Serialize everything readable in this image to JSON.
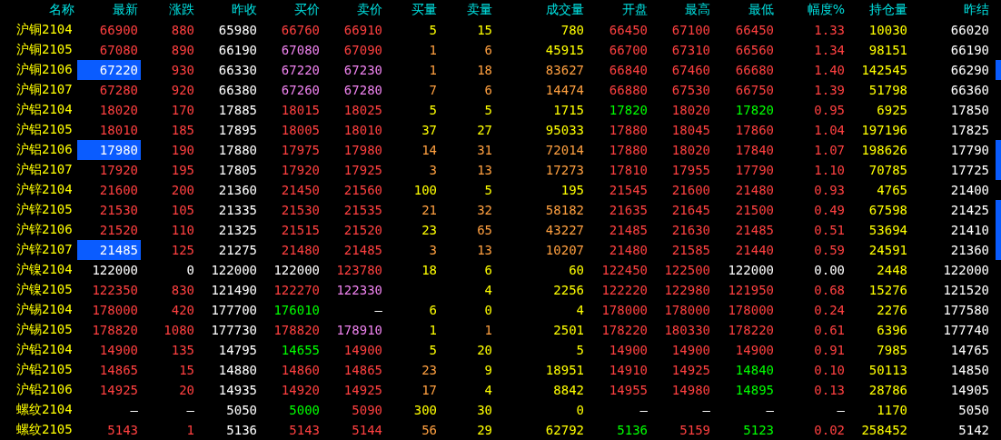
{
  "columns": [
    "名称",
    "最新",
    "涨跌",
    "昨收",
    "买价",
    "卖价",
    "买量",
    "卖量",
    "成交量",
    "开盘",
    "最高",
    "最低",
    "幅度%",
    "持仓量",
    "昨结"
  ],
  "rows": [
    {
      "name": "沪铜2104",
      "flash": false,
      "marked": false,
      "cells": [
        {
          "text": "66900",
          "color": "#ff4040"
        },
        {
          "text": "880",
          "color": "#ff4040"
        },
        {
          "text": "65980",
          "color": "#ffffff"
        },
        {
          "text": "66760",
          "color": "#ff4040"
        },
        {
          "text": "66910",
          "color": "#ff4040"
        },
        {
          "text": "5",
          "color": "#ffff00"
        },
        {
          "text": "15",
          "color": "#ffff00"
        },
        {
          "text": "780",
          "color": "#ffff00"
        },
        {
          "text": "66450",
          "color": "#ff4040"
        },
        {
          "text": "67100",
          "color": "#ff4040"
        },
        {
          "text": "66450",
          "color": "#ff4040"
        },
        {
          "text": "1.33",
          "color": "#ff4040"
        },
        {
          "text": "10030",
          "color": "#ffff00"
        },
        {
          "text": "66020",
          "color": "#ffffff"
        }
      ]
    },
    {
      "name": "沪铜2105",
      "flash": false,
      "marked": false,
      "cells": [
        {
          "text": "67080",
          "color": "#ff4040"
        },
        {
          "text": "890",
          "color": "#ff4040"
        },
        {
          "text": "66190",
          "color": "#ffffff"
        },
        {
          "text": "67080",
          "color": "#ee82ee"
        },
        {
          "text": "67090",
          "color": "#ff4040"
        },
        {
          "text": "1",
          "color": "#ffa040"
        },
        {
          "text": "6",
          "color": "#ffa040"
        },
        {
          "text": "45915",
          "color": "#ffff00"
        },
        {
          "text": "66700",
          "color": "#ff4040"
        },
        {
          "text": "67310",
          "color": "#ff4040"
        },
        {
          "text": "66560",
          "color": "#ff4040"
        },
        {
          "text": "1.34",
          "color": "#ff4040"
        },
        {
          "text": "98151",
          "color": "#ffff00"
        },
        {
          "text": "66190",
          "color": "#ffffff"
        }
      ]
    },
    {
      "name": "沪铜2106",
      "flash": true,
      "marked": true,
      "cells": [
        {
          "text": "67220",
          "color": "#ffffff"
        },
        {
          "text": "930",
          "color": "#ff4040"
        },
        {
          "text": "66330",
          "color": "#ffffff"
        },
        {
          "text": "67220",
          "color": "#ee82ee"
        },
        {
          "text": "67230",
          "color": "#ee82ee"
        },
        {
          "text": "1",
          "color": "#ffa040"
        },
        {
          "text": "18",
          "color": "#ffa040"
        },
        {
          "text": "83627",
          "color": "#ffa040"
        },
        {
          "text": "66840",
          "color": "#ff4040"
        },
        {
          "text": "67460",
          "color": "#ff4040"
        },
        {
          "text": "66680",
          "color": "#ff4040"
        },
        {
          "text": "1.40",
          "color": "#ff4040"
        },
        {
          "text": "142545",
          "color": "#ffff00"
        },
        {
          "text": "66290",
          "color": "#ffffff"
        }
      ]
    },
    {
      "name": "沪铜2107",
      "flash": false,
      "marked": false,
      "cells": [
        {
          "text": "67280",
          "color": "#ff4040"
        },
        {
          "text": "920",
          "color": "#ff4040"
        },
        {
          "text": "66380",
          "color": "#ffffff"
        },
        {
          "text": "67260",
          "color": "#ee82ee"
        },
        {
          "text": "67280",
          "color": "#ee82ee"
        },
        {
          "text": "7",
          "color": "#ffa040"
        },
        {
          "text": "6",
          "color": "#ffa040"
        },
        {
          "text": "14474",
          "color": "#ffa040"
        },
        {
          "text": "66880",
          "color": "#ff4040"
        },
        {
          "text": "67530",
          "color": "#ff4040"
        },
        {
          "text": "66750",
          "color": "#ff4040"
        },
        {
          "text": "1.39",
          "color": "#ff4040"
        },
        {
          "text": "51798",
          "color": "#ffff00"
        },
        {
          "text": "66360",
          "color": "#ffffff"
        }
      ]
    },
    {
      "name": "沪铝2104",
      "flash": false,
      "marked": false,
      "cells": [
        {
          "text": "18020",
          "color": "#ff4040"
        },
        {
          "text": "170",
          "color": "#ff4040"
        },
        {
          "text": "17885",
          "color": "#ffffff"
        },
        {
          "text": "18015",
          "color": "#ff4040"
        },
        {
          "text": "18025",
          "color": "#ff4040"
        },
        {
          "text": "5",
          "color": "#ffff00"
        },
        {
          "text": "5",
          "color": "#ffff00"
        },
        {
          "text": "1715",
          "color": "#ffff00"
        },
        {
          "text": "17820",
          "color": "#00ff00"
        },
        {
          "text": "18020",
          "color": "#ff4040"
        },
        {
          "text": "17820",
          "color": "#00ff00"
        },
        {
          "text": "0.95",
          "color": "#ff4040"
        },
        {
          "text": "6925",
          "color": "#ffff00"
        },
        {
          "text": "17850",
          "color": "#ffffff"
        }
      ]
    },
    {
      "name": "沪铝2105",
      "flash": false,
      "marked": false,
      "cells": [
        {
          "text": "18010",
          "color": "#ff4040"
        },
        {
          "text": "185",
          "color": "#ff4040"
        },
        {
          "text": "17895",
          "color": "#ffffff"
        },
        {
          "text": "18005",
          "color": "#ff4040"
        },
        {
          "text": "18010",
          "color": "#ff4040"
        },
        {
          "text": "37",
          "color": "#ffff00"
        },
        {
          "text": "27",
          "color": "#ffff00"
        },
        {
          "text": "95033",
          "color": "#ffff00"
        },
        {
          "text": "17880",
          "color": "#ff4040"
        },
        {
          "text": "18045",
          "color": "#ff4040"
        },
        {
          "text": "17860",
          "color": "#ff4040"
        },
        {
          "text": "1.04",
          "color": "#ff4040"
        },
        {
          "text": "197196",
          "color": "#ffff00"
        },
        {
          "text": "17825",
          "color": "#ffffff"
        }
      ]
    },
    {
      "name": "沪铝2106",
      "flash": true,
      "marked": true,
      "cells": [
        {
          "text": "17980",
          "color": "#ffffff"
        },
        {
          "text": "190",
          "color": "#ff4040"
        },
        {
          "text": "17880",
          "color": "#ffffff"
        },
        {
          "text": "17975",
          "color": "#ff4040"
        },
        {
          "text": "17980",
          "color": "#ff4040"
        },
        {
          "text": "14",
          "color": "#ffa040"
        },
        {
          "text": "31",
          "color": "#ffa040"
        },
        {
          "text": "72014",
          "color": "#ffa040"
        },
        {
          "text": "17880",
          "color": "#ff4040"
        },
        {
          "text": "18020",
          "color": "#ff4040"
        },
        {
          "text": "17840",
          "color": "#ff4040"
        },
        {
          "text": "1.07",
          "color": "#ff4040"
        },
        {
          "text": "198626",
          "color": "#ffff00"
        },
        {
          "text": "17790",
          "color": "#ffffff"
        }
      ]
    },
    {
      "name": "沪铝2107",
      "flash": false,
      "marked": true,
      "cells": [
        {
          "text": "17920",
          "color": "#ff4040"
        },
        {
          "text": "195",
          "color": "#ff4040"
        },
        {
          "text": "17805",
          "color": "#ffffff"
        },
        {
          "text": "17920",
          "color": "#ff4040"
        },
        {
          "text": "17925",
          "color": "#ff4040"
        },
        {
          "text": "3",
          "color": "#ffa040"
        },
        {
          "text": "13",
          "color": "#ffa040"
        },
        {
          "text": "17273",
          "color": "#ffa040"
        },
        {
          "text": "17810",
          "color": "#ff4040"
        },
        {
          "text": "17955",
          "color": "#ff4040"
        },
        {
          "text": "17790",
          "color": "#ff4040"
        },
        {
          "text": "1.10",
          "color": "#ff4040"
        },
        {
          "text": "70785",
          "color": "#ffff00"
        },
        {
          "text": "17725",
          "color": "#ffffff"
        }
      ]
    },
    {
      "name": "沪锌2104",
      "flash": false,
      "marked": false,
      "cells": [
        {
          "text": "21600",
          "color": "#ff4040"
        },
        {
          "text": "200",
          "color": "#ff4040"
        },
        {
          "text": "21360",
          "color": "#ffffff"
        },
        {
          "text": "21450",
          "color": "#ff4040"
        },
        {
          "text": "21560",
          "color": "#ff4040"
        },
        {
          "text": "100",
          "color": "#ffff00"
        },
        {
          "text": "5",
          "color": "#ffff00"
        },
        {
          "text": "195",
          "color": "#ffff00"
        },
        {
          "text": "21545",
          "color": "#ff4040"
        },
        {
          "text": "21600",
          "color": "#ff4040"
        },
        {
          "text": "21480",
          "color": "#ff4040"
        },
        {
          "text": "0.93",
          "color": "#ff4040"
        },
        {
          "text": "4765",
          "color": "#ffff00"
        },
        {
          "text": "21400",
          "color": "#ffffff"
        }
      ]
    },
    {
      "name": "沪锌2105",
      "flash": false,
      "marked": true,
      "cells": [
        {
          "text": "21530",
          "color": "#ff4040"
        },
        {
          "text": "105",
          "color": "#ff4040"
        },
        {
          "text": "21335",
          "color": "#ffffff"
        },
        {
          "text": "21530",
          "color": "#ff4040"
        },
        {
          "text": "21535",
          "color": "#ff4040"
        },
        {
          "text": "21",
          "color": "#ffa040"
        },
        {
          "text": "32",
          "color": "#ffa040"
        },
        {
          "text": "58182",
          "color": "#ffa040"
        },
        {
          "text": "21635",
          "color": "#ff4040"
        },
        {
          "text": "21645",
          "color": "#ff4040"
        },
        {
          "text": "21500",
          "color": "#ff4040"
        },
        {
          "text": "0.49",
          "color": "#ff4040"
        },
        {
          "text": "67598",
          "color": "#ffff00"
        },
        {
          "text": "21425",
          "color": "#ffffff"
        }
      ]
    },
    {
      "name": "沪锌2106",
      "flash": false,
      "marked": true,
      "cells": [
        {
          "text": "21520",
          "color": "#ff4040"
        },
        {
          "text": "110",
          "color": "#ff4040"
        },
        {
          "text": "21325",
          "color": "#ffffff"
        },
        {
          "text": "21515",
          "color": "#ff4040"
        },
        {
          "text": "21520",
          "color": "#ff4040"
        },
        {
          "text": "23",
          "color": "#ffff00"
        },
        {
          "text": "65",
          "color": "#ffa040"
        },
        {
          "text": "43227",
          "color": "#ffa040"
        },
        {
          "text": "21485",
          "color": "#ff4040"
        },
        {
          "text": "21630",
          "color": "#ff4040"
        },
        {
          "text": "21485",
          "color": "#ff4040"
        },
        {
          "text": "0.51",
          "color": "#ff4040"
        },
        {
          "text": "53694",
          "color": "#ffff00"
        },
        {
          "text": "21410",
          "color": "#ffffff"
        }
      ]
    },
    {
      "name": "沪锌2107",
      "flash": true,
      "marked": true,
      "cells": [
        {
          "text": "21485",
          "color": "#ffffff"
        },
        {
          "text": "125",
          "color": "#ff4040"
        },
        {
          "text": "21275",
          "color": "#ffffff"
        },
        {
          "text": "21480",
          "color": "#ff4040"
        },
        {
          "text": "21485",
          "color": "#ff4040"
        },
        {
          "text": "3",
          "color": "#ffa040"
        },
        {
          "text": "13",
          "color": "#ffa040"
        },
        {
          "text": "10207",
          "color": "#ffa040"
        },
        {
          "text": "21480",
          "color": "#ff4040"
        },
        {
          "text": "21585",
          "color": "#ff4040"
        },
        {
          "text": "21440",
          "color": "#ff4040"
        },
        {
          "text": "0.59",
          "color": "#ff4040"
        },
        {
          "text": "24591",
          "color": "#ffff00"
        },
        {
          "text": "21360",
          "color": "#ffffff"
        }
      ]
    },
    {
      "name": "沪镍2104",
      "flash": false,
      "marked": false,
      "cells": [
        {
          "text": "122000",
          "color": "#ffffff"
        },
        {
          "text": "0",
          "color": "#ffffff"
        },
        {
          "text": "122000",
          "color": "#ffffff"
        },
        {
          "text": "122000",
          "color": "#ffffff"
        },
        {
          "text": "123780",
          "color": "#ff4040"
        },
        {
          "text": "18",
          "color": "#ffff00"
        },
        {
          "text": "6",
          "color": "#ffff00"
        },
        {
          "text": "60",
          "color": "#ffff00"
        },
        {
          "text": "122450",
          "color": "#ff4040"
        },
        {
          "text": "122500",
          "color": "#ff4040"
        },
        {
          "text": "122000",
          "color": "#ffffff"
        },
        {
          "text": "0.00",
          "color": "#ffffff"
        },
        {
          "text": "2448",
          "color": "#ffff00"
        },
        {
          "text": "122000",
          "color": "#ffffff"
        }
      ]
    },
    {
      "name": "沪镍2105",
      "flash": false,
      "marked": false,
      "cells": [
        {
          "text": "122350",
          "color": "#ff4040"
        },
        {
          "text": "830",
          "color": "#ff4040"
        },
        {
          "text": "121490",
          "color": "#ffffff"
        },
        {
          "text": "122270",
          "color": "#ff4040"
        },
        {
          "text": "122330",
          "color": "#ee82ee"
        },
        null,
        {
          "text": "4",
          "color": "#ffff00"
        },
        {
          "text": "2256",
          "color": "#ffff00"
        },
        {
          "text": "122220",
          "color": "#ff4040"
        },
        {
          "text": "122980",
          "color": "#ff4040"
        },
        {
          "text": "121950",
          "color": "#ff4040"
        },
        {
          "text": "0.68",
          "color": "#ff4040"
        },
        {
          "text": "15276",
          "color": "#ffff00"
        },
        {
          "text": "121520",
          "color": "#ffffff"
        }
      ]
    },
    {
      "name": "沪锡2104",
      "flash": false,
      "marked": false,
      "cells": [
        {
          "text": "178000",
          "color": "#ff4040"
        },
        {
          "text": "420",
          "color": "#ff4040"
        },
        {
          "text": "177700",
          "color": "#ffffff"
        },
        {
          "text": "176010",
          "color": "#00ff00"
        },
        {
          "text": "—",
          "color": "#ffffff"
        },
        {
          "text": "6",
          "color": "#ffff00"
        },
        {
          "text": "0",
          "color": "#ffff00"
        },
        {
          "text": "4",
          "color": "#ffff00"
        },
        {
          "text": "178000",
          "color": "#ff4040"
        },
        {
          "text": "178000",
          "color": "#ff4040"
        },
        {
          "text": "178000",
          "color": "#ff4040"
        },
        {
          "text": "0.24",
          "color": "#ff4040"
        },
        {
          "text": "2276",
          "color": "#ffff00"
        },
        {
          "text": "177580",
          "color": "#ffffff"
        }
      ]
    },
    {
      "name": "沪锡2105",
      "flash": false,
      "marked": false,
      "cells": [
        {
          "text": "178820",
          "color": "#ff4040"
        },
        {
          "text": "1080",
          "color": "#ff4040"
        },
        {
          "text": "177730",
          "color": "#ffffff"
        },
        {
          "text": "178820",
          "color": "#ff4040"
        },
        {
          "text": "178910",
          "color": "#ee82ee"
        },
        {
          "text": "1",
          "color": "#ffff00"
        },
        {
          "text": "1",
          "color": "#ffa040"
        },
        {
          "text": "2501",
          "color": "#ffff00"
        },
        {
          "text": "178220",
          "color": "#ff4040"
        },
        {
          "text": "180330",
          "color": "#ff4040"
        },
        {
          "text": "178220",
          "color": "#ff4040"
        },
        {
          "text": "0.61",
          "color": "#ff4040"
        },
        {
          "text": "6396",
          "color": "#ffff00"
        },
        {
          "text": "177740",
          "color": "#ffffff"
        }
      ]
    },
    {
      "name": "沪铅2104",
      "flash": false,
      "marked": false,
      "cells": [
        {
          "text": "14900",
          "color": "#ff4040"
        },
        {
          "text": "135",
          "color": "#ff4040"
        },
        {
          "text": "14795",
          "color": "#ffffff"
        },
        {
          "text": "14655",
          "color": "#00ff00"
        },
        {
          "text": "14900",
          "color": "#ff4040"
        },
        {
          "text": "5",
          "color": "#ffff00"
        },
        {
          "text": "20",
          "color": "#ffff00"
        },
        {
          "text": "5",
          "color": "#ffff00"
        },
        {
          "text": "14900",
          "color": "#ff4040"
        },
        {
          "text": "14900",
          "color": "#ff4040"
        },
        {
          "text": "14900",
          "color": "#ff4040"
        },
        {
          "text": "0.91",
          "color": "#ff4040"
        },
        {
          "text": "7985",
          "color": "#ffff00"
        },
        {
          "text": "14765",
          "color": "#ffffff"
        }
      ]
    },
    {
      "name": "沪铅2105",
      "flash": false,
      "marked": false,
      "cells": [
        {
          "text": "14865",
          "color": "#ff4040"
        },
        {
          "text": "15",
          "color": "#ff4040"
        },
        {
          "text": "14880",
          "color": "#ffffff"
        },
        {
          "text": "14860",
          "color": "#ff4040"
        },
        {
          "text": "14865",
          "color": "#ff4040"
        },
        {
          "text": "23",
          "color": "#ffa040"
        },
        {
          "text": "9",
          "color": "#ffff00"
        },
        {
          "text": "18951",
          "color": "#ffff00"
        },
        {
          "text": "14910",
          "color": "#ff4040"
        },
        {
          "text": "14925",
          "color": "#ff4040"
        },
        {
          "text": "14840",
          "color": "#00ff00"
        },
        {
          "text": "0.10",
          "color": "#ff4040"
        },
        {
          "text": "50113",
          "color": "#ffff00"
        },
        {
          "text": "14850",
          "color": "#ffffff"
        }
      ]
    },
    {
      "name": "沪铅2106",
      "flash": false,
      "marked": false,
      "cells": [
        {
          "text": "14925",
          "color": "#ff4040"
        },
        {
          "text": "20",
          "color": "#ff4040"
        },
        {
          "text": "14935",
          "color": "#ffffff"
        },
        {
          "text": "14920",
          "color": "#ff4040"
        },
        {
          "text": "14925",
          "color": "#ff4040"
        },
        {
          "text": "17",
          "color": "#ffa040"
        },
        {
          "text": "4",
          "color": "#ffff00"
        },
        {
          "text": "8842",
          "color": "#ffff00"
        },
        {
          "text": "14955",
          "color": "#ff4040"
        },
        {
          "text": "14980",
          "color": "#ff4040"
        },
        {
          "text": "14895",
          "color": "#00ff00"
        },
        {
          "text": "0.13",
          "color": "#ff4040"
        },
        {
          "text": "28786",
          "color": "#ffff00"
        },
        {
          "text": "14905",
          "color": "#ffffff"
        }
      ]
    },
    {
      "name": "螺纹2104",
      "flash": false,
      "marked": false,
      "cells": [
        {
          "text": "—",
          "color": "#ffffff"
        },
        {
          "text": "—",
          "color": "#ffffff"
        },
        {
          "text": "5050",
          "color": "#ffffff"
        },
        {
          "text": "5000",
          "color": "#00ff00"
        },
        {
          "text": "5090",
          "color": "#ff4040"
        },
        {
          "text": "300",
          "color": "#ffff00"
        },
        {
          "text": "30",
          "color": "#ffff00"
        },
        {
          "text": "0",
          "color": "#ffff00"
        },
        {
          "text": "—",
          "color": "#ffffff"
        },
        {
          "text": "—",
          "color": "#ffffff"
        },
        {
          "text": "—",
          "color": "#ffffff"
        },
        {
          "text": "—",
          "color": "#ffffff"
        },
        {
          "text": "1170",
          "color": "#ffff00"
        },
        {
          "text": "5050",
          "color": "#ffffff"
        }
      ]
    },
    {
      "name": "螺纹2105",
      "flash": false,
      "marked": false,
      "cells": [
        {
          "text": "5143",
          "color": "#ff4040"
        },
        {
          "text": "1",
          "color": "#ff4040"
        },
        {
          "text": "5136",
          "color": "#ffffff"
        },
        {
          "text": "5143",
          "color": "#ff4040"
        },
        {
          "text": "5144",
          "color": "#ff4040"
        },
        {
          "text": "56",
          "color": "#ffa040"
        },
        {
          "text": "29",
          "color": "#ffff00"
        },
        {
          "text": "62792",
          "color": "#ffff00"
        },
        {
          "text": "5136",
          "color": "#00ff00"
        },
        {
          "text": "5159",
          "color": "#ff4040"
        },
        {
          "text": "5123",
          "color": "#00ff00"
        },
        {
          "text": "0.02",
          "color": "#ff4040"
        },
        {
          "text": "258452",
          "color": "#ffff00"
        },
        {
          "text": "5142",
          "color": "#ffffff"
        }
      ]
    }
  ]
}
